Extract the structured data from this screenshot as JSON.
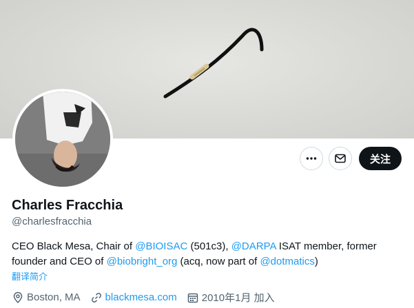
{
  "profile": {
    "display_name": "Charles Fracchia",
    "handle": "@charlesfracchia",
    "bio": {
      "t1": "CEO Black Mesa, Chair of ",
      "m1": "@BIOISAC",
      "t2": " (501c3), ",
      "m2": "@DARPA",
      "t3": " ISAT member, former founder and CEO of ",
      "m3": "@biobright_org",
      "t4": " (acq, now part of ",
      "m4": "@dotmatics",
      "t5": ")"
    },
    "translate_label": "翻译简介",
    "location": "Boston, MA",
    "website": "blackmesa.com",
    "joined": "2010年1月 加入"
  },
  "actions": {
    "follow_label": "关注"
  },
  "icons": {
    "more": "more-dots-icon",
    "message": "envelope-icon",
    "location": "location-pin-icon",
    "website": "link-icon",
    "joined": "calendar-icon"
  },
  "colors": {
    "accent": "#1d9bf0",
    "text": "#0f1419",
    "secondary": "#536471",
    "button_dark": "#0f1419"
  }
}
